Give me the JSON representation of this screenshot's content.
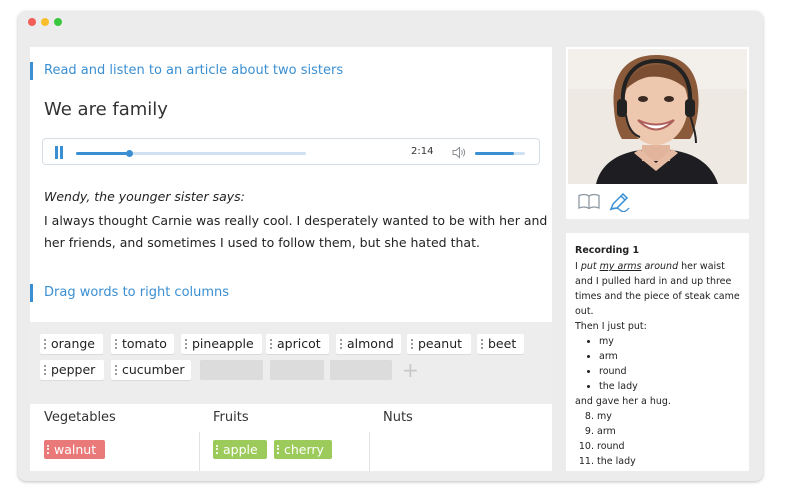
{
  "window": {
    "controls": [
      "close",
      "minimize",
      "zoom"
    ]
  },
  "lesson": {
    "section1_title": "Read and listen to an article about two sisters",
    "article_title": "We are family",
    "player": {
      "time": "2:14",
      "progress": 0.23,
      "buffered": 0.5,
      "volume": 0.78
    },
    "speaker": "Wendy, the younger sister says:",
    "text": "I always thought Carnie was really cool. I desperately wanted to be with her and her friends, and sometimes I used to follow them, but she hated that.",
    "section2_title": "Drag words to right columns",
    "word_bank": [
      "orange",
      "tomato",
      "pineapple",
      "apricot",
      "almond",
      "peanut",
      "beet",
      "pepper",
      "cucumber"
    ],
    "columns": [
      {
        "title": "Vegetables",
        "items": [
          "walnut"
        ],
        "status": "wrong"
      },
      {
        "title": "Fruits",
        "items": [
          "apple",
          "cherry"
        ],
        "status": "correct"
      },
      {
        "title": "Nuts",
        "items": []
      }
    ],
    "colors": {
      "accent": "#3a8fd3",
      "correct": "#9ccb5b",
      "wrong": "#ea7a7a"
    }
  },
  "sidebar": {
    "icons": [
      "book-icon",
      "pen-icon"
    ],
    "recording": {
      "title": "Recording 1",
      "line1_pre": "I ",
      "line1_put": "put",
      "line1_space": " ",
      "line1_myarms": "my arms",
      "line1_around": " around",
      "line1_post": " her waist and I pulled hard in and up three times and the piece of steak came out.",
      "line2": "Then I just put:",
      "bullets": [
        "my",
        "arm",
        "round",
        "the lady"
      ],
      "line3": "and gave her a hug.",
      "numbered_start": 8,
      "numbered": [
        "my",
        "arm",
        "round",
        "the lady"
      ]
    }
  }
}
